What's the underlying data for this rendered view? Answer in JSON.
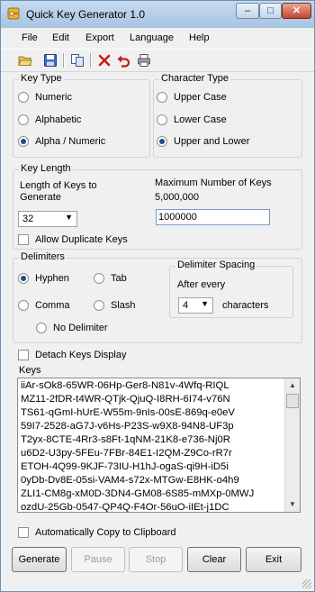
{
  "window": {
    "title": "Quick Key Generator 1.0"
  },
  "menu": [
    "File",
    "Edit",
    "Export",
    "Language",
    "Help"
  ],
  "key_type": {
    "title": "Key Type",
    "options": [
      "Numeric",
      "Alphabetic",
      "Alpha / Numeric"
    ],
    "selected": "Alpha / Numeric"
  },
  "character_type": {
    "title": "Character Type",
    "options": [
      "Upper Case",
      "Lower Case",
      "Upper and Lower"
    ],
    "selected": "Upper and Lower"
  },
  "key_length": {
    "title": "Key Length",
    "length_label": "Length of Keys to Generate",
    "length_value": "32",
    "max_label": "Maximum Number of Keys",
    "max_value": "5,000,000",
    "count_value": "1000000",
    "allow_duplicates_label": "Allow Duplicate Keys"
  },
  "delimiters": {
    "title": "Delimiters",
    "options": [
      "Hyphen",
      "Tab",
      "Comma",
      "Slash",
      "No Delimiter"
    ],
    "selected": "Hyphen"
  },
  "spacing": {
    "title": "Delimiter Spacing",
    "after_label": "After every",
    "value": "4",
    "unit_label": "characters"
  },
  "detach_label": "Detach Keys Display",
  "keys": {
    "label": "Keys",
    "lines": [
      "iiAr-sOk8-65WR-06Hp-Ger8-N81v-4Wfq-RIQL",
      "MZ11-2fDR-t4WR-QTjk-QjuQ-I8RH-6I74-v76N",
      "TS61-qGmI-hUrE-W55m-9nIs-00sE-869q-e0eV",
      "59I7-2528-aG7J-v6Hs-P23S-w9X8-94N8-UF3p",
      "T2yx-8CTE-4Rr3-s8Ft-1qNM-21K8-e736-Nj0R",
      "u6D2-U3py-5FEu-7FBr-84E1-I2QM-Z9Co-rR7r",
      "ETOH-4Q99-9KJF-73IU-H1hJ-ogaS-qi9H-iD5i",
      "0yDb-Dv8E-05si-VAM4-s72x-MTGw-E8HK-o4h9",
      "ZLI1-CM8g-xM0D-3DN4-GM08-6S85-mMXp-0MWJ",
      "ozdU-25Gb-0547-QP4Q-F4Or-56uO-iIEt-j1DC"
    ]
  },
  "auto_copy_label": "Automatically Copy to Clipboard",
  "buttons": {
    "generate": "Generate",
    "pause": "Pause",
    "stop": "Stop",
    "clear": "Clear",
    "exit": "Exit"
  }
}
